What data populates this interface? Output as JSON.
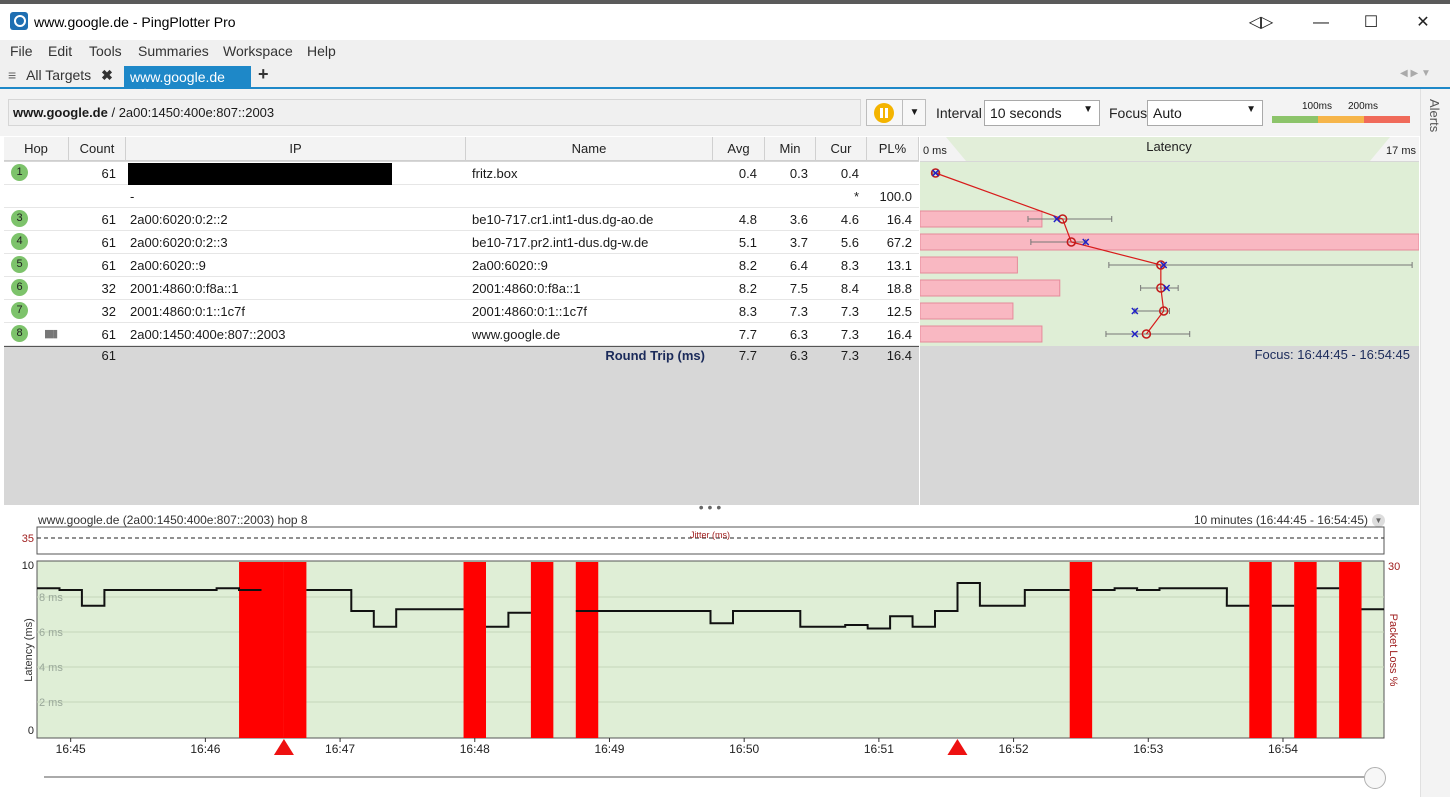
{
  "window": {
    "title": "www.google.de - PingPlotter Pro"
  },
  "menu": [
    "File",
    "Edit",
    "Tools",
    "Summaries",
    "Workspace",
    "Help"
  ],
  "tabs": {
    "all_targets": "All Targets",
    "active": "www.google.de"
  },
  "target": {
    "host": "www.google.de",
    "separator": " / ",
    "address": "2a00:1450:400e:807::2003"
  },
  "controls": {
    "interval_label": "Interval",
    "interval_value": "10 seconds",
    "focus_label": "Focus",
    "focus_value": "Auto",
    "scale_100": "100ms",
    "scale_200": "200ms"
  },
  "alerts_label": "Alerts",
  "table": {
    "headers": {
      "hop": "Hop",
      "count": "Count",
      "ip": "IP",
      "name": "Name",
      "avg": "Avg",
      "min": "Min",
      "cur": "Cur",
      "pl": "PL%"
    },
    "rows": [
      {
        "hop": "1",
        "count": "61",
        "ip": "",
        "name": "fritz.box",
        "avg": "0.4",
        "min": "0.3",
        "cur": "0.4",
        "pl": ""
      },
      {
        "hop": "",
        "count": "",
        "ip": "-",
        "name": "",
        "avg": "",
        "min": "",
        "cur": "*",
        "pl": "100.0"
      },
      {
        "hop": "3",
        "count": "61",
        "ip": "2a00:6020:0:2::2",
        "name": "be10-717.cr1.int1-dus.dg-ao.de",
        "avg": "4.8",
        "min": "3.6",
        "cur": "4.6",
        "pl": "16.4"
      },
      {
        "hop": "4",
        "count": "61",
        "ip": "2a00:6020:0:2::3",
        "name": "be10-717.pr2.int1-dus.dg-w.de",
        "avg": "5.1",
        "min": "3.7",
        "cur": "5.6",
        "pl": "67.2"
      },
      {
        "hop": "5",
        "count": "61",
        "ip": "2a00:6020::9",
        "name": "2a00:6020::9",
        "avg": "8.2",
        "min": "6.4",
        "cur": "8.3",
        "pl": "13.1"
      },
      {
        "hop": "6",
        "count": "32",
        "ip": "2001:4860:0:f8a::1",
        "name": "2001:4860:0:f8a::1",
        "avg": "8.2",
        "min": "7.5",
        "cur": "8.4",
        "pl": "18.8"
      },
      {
        "hop": "7",
        "count": "32",
        "ip": "2001:4860:0:1::1c7f",
        "name": "2001:4860:0:1::1c7f",
        "avg": "8.3",
        "min": "7.3",
        "cur": "7.3",
        "pl": "12.5"
      },
      {
        "hop": "8",
        "count": "61",
        "ip": "2a00:1450:400e:807::2003",
        "name": "www.google.de",
        "avg": "7.7",
        "min": "6.3",
        "cur": "7.3",
        "pl": "16.4"
      }
    ],
    "total": {
      "count": "61",
      "label": "Round Trip (ms)",
      "avg": "7.7",
      "min": "6.3",
      "cur": "7.3",
      "pl": "16.4",
      "focus": "Focus: 16:44:45 - 16:54:45"
    }
  },
  "latency_graph": {
    "header": "Latency",
    "min_label": "0 ms",
    "max_label": "17 ms",
    "max_ms": 17,
    "hops": [
      {
        "avg": 0.4,
        "min": 0.3,
        "max": 0.5,
        "cur": 0.4,
        "pl": 0
      },
      null,
      {
        "avg": 4.8,
        "min": 3.6,
        "max": 6.5,
        "cur": 4.6,
        "pl": 16.4
      },
      {
        "avg": 5.1,
        "min": 3.7,
        "max": 5.6,
        "cur": 5.6,
        "pl": 67.2
      },
      {
        "avg": 8.2,
        "min": 6.4,
        "max": 16.9,
        "cur": 8.3,
        "pl": 13.1
      },
      {
        "avg": 8.2,
        "min": 7.5,
        "max": 8.8,
        "cur": 8.4,
        "pl": 18.8
      },
      {
        "avg": 8.3,
        "min": 7.3,
        "max": 8.5,
        "cur": 7.3,
        "pl": 12.5
      },
      {
        "avg": 7.7,
        "min": 6.3,
        "max": 9.2,
        "cur": 7.3,
        "pl": 16.4
      }
    ]
  },
  "timeline": {
    "title": "www.google.de (2a00:1450:400e:807::2003) hop 8",
    "range": "10 minutes (16:44:45 - 16:54:45)",
    "jitter_label": "Jitter (ms)",
    "jitter_value": "35",
    "ylabel": "Latency (ms)",
    "y2label": "Packet Loss %",
    "y_max": "10",
    "y_min": "0",
    "y2_max": "30",
    "y_ticks": [
      "8 ms",
      "6 ms",
      "4 ms",
      "2 ms"
    ],
    "x_ticks": [
      "16:45",
      "16:46",
      "16:47",
      "16:48",
      "16:49",
      "16:50",
      "16:51",
      "16:52",
      "16:53",
      "16:54"
    ]
  },
  "chart_data": {
    "type": "line",
    "title": "www.google.de (2a00:1450:400e:807::2003) hop 8",
    "ylabel": "Latency (ms)",
    "y2label": "Packet Loss %",
    "ylim": [
      0,
      10
    ],
    "y2lim": [
      0,
      30
    ],
    "x_start": "16:44:45",
    "x_end": "16:54:45",
    "series": [
      {
        "name": "Latency (ms)",
        "x": [
          "16:44:45",
          "16:44:55",
          "16:45:05",
          "16:45:15",
          "16:45:25",
          "16:45:35",
          "16:45:45",
          "16:45:55",
          "16:46:05",
          "16:46:15",
          "16:46:25",
          "16:46:35",
          "16:46:45",
          "16:46:55",
          "16:47:05",
          "16:47:15",
          "16:47:25",
          "16:47:35",
          "16:47:45",
          "16:47:55",
          "16:48:05",
          "16:48:15",
          "16:48:25",
          "16:48:35",
          "16:48:45",
          "16:48:55",
          "16:49:05",
          "16:49:15",
          "16:49:25",
          "16:49:35",
          "16:49:45",
          "16:49:55",
          "16:50:05",
          "16:50:15",
          "16:50:25",
          "16:50:35",
          "16:50:45",
          "16:50:55",
          "16:51:05",
          "16:51:15",
          "16:51:25",
          "16:51:35",
          "16:51:45",
          "16:51:55",
          "16:52:05",
          "16:52:15",
          "16:52:25",
          "16:52:35",
          "16:52:45",
          "16:52:55",
          "16:53:05",
          "16:53:15",
          "16:53:25",
          "16:53:35",
          "16:53:45",
          "16:53:55",
          "16:54:05",
          "16:54:15",
          "16:54:25",
          "16:54:35"
        ],
        "values": [
          8.5,
          8.4,
          7.5,
          8.4,
          8.4,
          8.4,
          8.4,
          8.4,
          8.5,
          8.4,
          null,
          null,
          8.4,
          8.4,
          7.2,
          6.3,
          7.3,
          7.3,
          7.3,
          null,
          6.3,
          7.1,
          null,
          null,
          7.2,
          7.2,
          7.2,
          7.2,
          7.2,
          7.2,
          6.5,
          7.2,
          7.2,
          7.2,
          6.3,
          6.3,
          6.4,
          6.2,
          6.9,
          6.3,
          7.2,
          8.8,
          7.5,
          7.5,
          8.4,
          8.4,
          null,
          8.4,
          8.5,
          8.4,
          8.5,
          8.5,
          8.5,
          7.5,
          null,
          7.5,
          null,
          8.5,
          null,
          7.3
        ]
      },
      {
        "name": "Packet Loss %",
        "x": [
          "16:46:15",
          "16:46:25",
          "16:46:35",
          "16:47:55",
          "16:48:25",
          "16:48:45",
          "16:52:25",
          "16:53:45",
          "16:54:05",
          "16:54:25"
        ],
        "values": [
          100,
          100,
          100,
          100,
          100,
          100,
          100,
          100,
          100,
          100
        ]
      }
    ],
    "annotations": [
      "16:46:35",
      "16:51:35"
    ],
    "grid": true
  }
}
